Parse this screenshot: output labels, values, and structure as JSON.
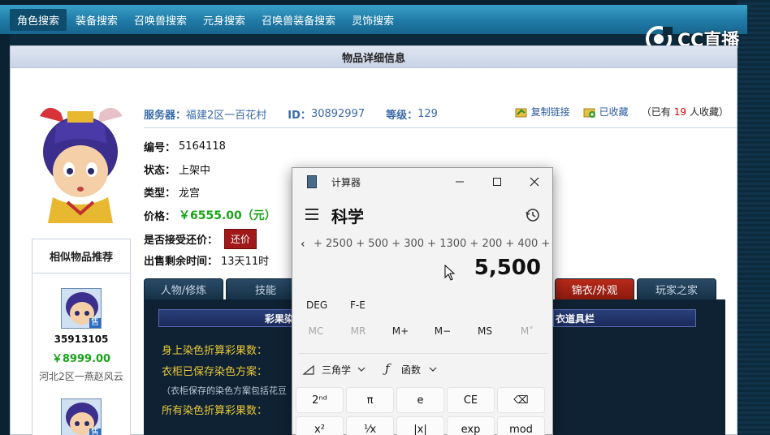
{
  "nav": {
    "items": [
      "角色搜索",
      "装备搜索",
      "召唤兽搜索",
      "元身搜索",
      "召唤兽装备搜索",
      "灵饰搜索"
    ],
    "active_index": 0
  },
  "watermark": {
    "text": "CC直播"
  },
  "panel": {
    "title": "物品详细信息"
  },
  "item": {
    "server_label": "服务器：",
    "server_value": "福建2区一百花村",
    "id_label": "ID：",
    "id_value": "30892997",
    "level_label": "等级：",
    "level_value": "129",
    "copy_link": "复制链接",
    "favorited": "已收藏",
    "fav_count_prefix": "（已有",
    "fav_count": "19",
    "fav_count_suffix": "人收藏）",
    "number_label": "编号：",
    "number_value": "5164118",
    "status_label": "状态：",
    "status_value": "上架中",
    "type_label": "类型：",
    "type_value": "龙宫",
    "price_label": "价格：",
    "price_value": "￥6555.00（元）",
    "bargain_label": "是否接受还价：",
    "bargain_button": "还价",
    "remaining_label": "出售剩余时间：",
    "remaining_value": "13天11时"
  },
  "similar": {
    "title": "相似物品推荐",
    "items": [
      {
        "id": "35913105",
        "price": "￥8999.00",
        "server": "河北2区一燕赵风云",
        "badge": "售"
      },
      {
        "badge": "售"
      }
    ]
  },
  "tabs": {
    "items": [
      "人物/修炼",
      "技能",
      "锦衣/外观",
      "玩家之家"
    ],
    "active": "锦衣/外观"
  },
  "content": {
    "bar_left": "彩果染",
    "bar_right": "衣道具栏",
    "line1": "身上染色折算彩果数：",
    "line2": "衣柜已保存染色方案：",
    "note": "（衣柜保存的染色方案包括花豆",
    "line3": "所有染色折算彩果数："
  },
  "calculator": {
    "window_title": "计算器",
    "mode": "科学",
    "expression": "+ 2500 + 500 + 300 + 1300 + 200 + 400 + 300 +",
    "display": "5,500",
    "deg": "DEG",
    "fe": "F-E",
    "memory": [
      "MC",
      "MR",
      "M+",
      "M−",
      "MS",
      "M˅"
    ],
    "trig": "三角学",
    "func": "函数",
    "keys_row1": [
      "2ⁿᵈ",
      "π",
      "e",
      "CE",
      "⌫"
    ],
    "keys_row2": [
      "x²",
      "¹⁄x",
      "|x|",
      "exp",
      "mod"
    ]
  }
}
